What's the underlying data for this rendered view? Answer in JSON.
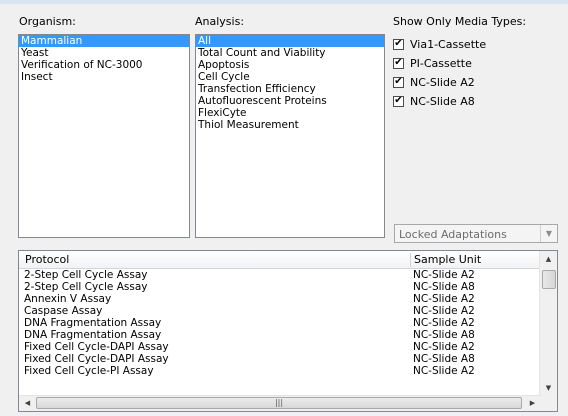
{
  "organism": {
    "label": "Organism:",
    "items": [
      "Mammalian",
      "Yeast",
      "Verification of NC-3000",
      "Insect"
    ],
    "selected": "Mammalian"
  },
  "analysis": {
    "label": "Analysis:",
    "items": [
      "All",
      "Total Count and Viability",
      "Apoptosis",
      "Cell Cycle",
      "Transfection Efficiency",
      "Autofluorescent Proteins",
      "FlexiCyte",
      "Thiol Measurement"
    ],
    "selected": "All"
  },
  "media": {
    "label": "Show Only Media Types:",
    "items": [
      {
        "label": "Via1-Cassette",
        "checked": true
      },
      {
        "label": "PI-Cassette",
        "checked": true
      },
      {
        "label": "NC-Slide A2",
        "checked": true
      },
      {
        "label": "NC-Slide A8",
        "checked": true
      }
    ]
  },
  "adaptations": {
    "value": "Locked Adaptations"
  },
  "protocols": {
    "columns": [
      "Protocol",
      "Sample Unit"
    ],
    "rows": [
      [
        "2-Step Cell Cycle Assay",
        "NC-Slide A2"
      ],
      [
        "2-Step Cell Cycle Assay",
        "NC-Slide A8"
      ],
      [
        "Annexin V Assay",
        "NC-Slide A2"
      ],
      [
        "Caspase Assay",
        "NC-Slide A2"
      ],
      [
        "DNA Fragmentation Assay",
        "NC-Slide A2"
      ],
      [
        "DNA Fragmentation Assay",
        "NC-Slide A8"
      ],
      [
        "Fixed Cell Cycle-DAPI Assay",
        "NC-Slide A2"
      ],
      [
        "Fixed Cell Cycle-DAPI Assay",
        "NC-Slide A8"
      ],
      [
        "Fixed Cell Cycle-PI Assay",
        "NC-Slide A2"
      ]
    ]
  },
  "colors": {
    "selection": "#3399ff",
    "background": "#f0f0f0",
    "border": "#828790"
  },
  "icons": {
    "check": "checkmark-icon",
    "scroll_up": "arrow-up-icon",
    "scroll_down": "arrow-down-icon",
    "scroll_left": "arrow-left-icon",
    "scroll_right": "arrow-right-icon",
    "dropdown": "chevron-down-icon"
  }
}
